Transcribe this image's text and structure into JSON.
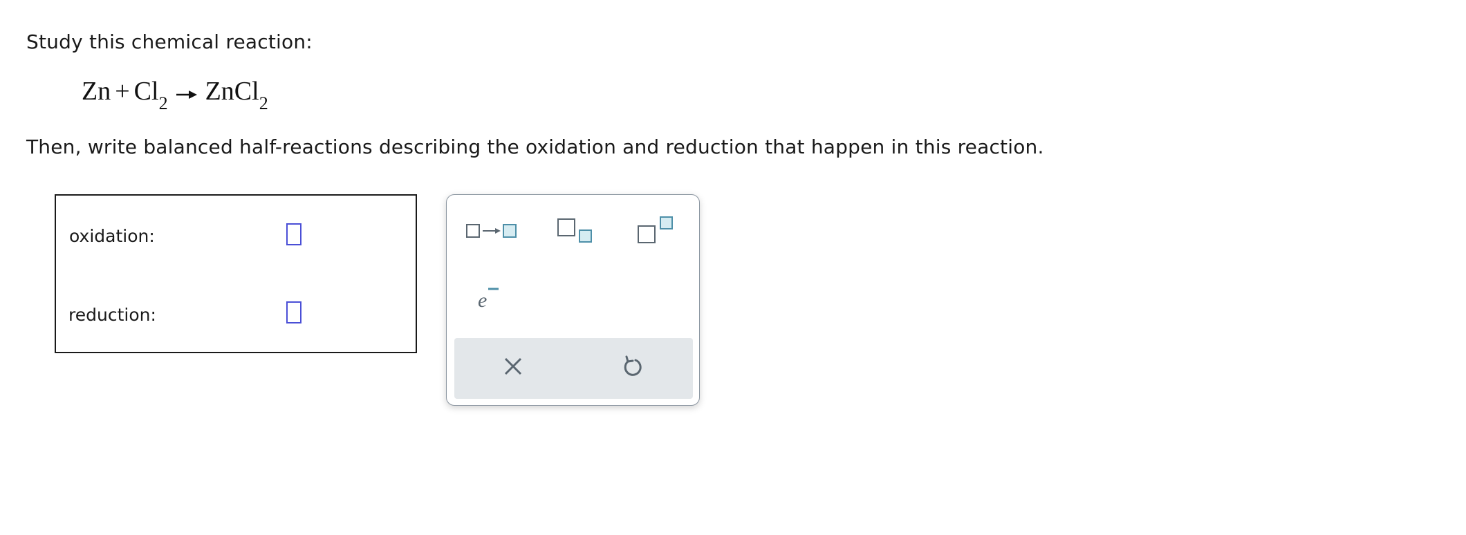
{
  "question": {
    "prompt": "Study this chemical reaction:",
    "equation": {
      "reactant1": "Zn",
      "plus": "+",
      "reactant2_symbol": "Cl",
      "reactant2_subscript": "2",
      "product_symbol": "ZnCl",
      "product_subscript": "2"
    },
    "instruction": "Then, write balanced half-reactions describing the oxidation and reduction that happen in this reaction."
  },
  "answer": {
    "rows": [
      {
        "label": "oxidation:",
        "value": ""
      },
      {
        "label": "reduction:",
        "value": ""
      }
    ]
  },
  "palette": {
    "tools": [
      "reaction-arrow-template",
      "subscript-template",
      "superscript-template",
      "electron"
    ],
    "electron_label": "e",
    "actions": [
      "clear",
      "undo"
    ],
    "colors": {
      "accent": "#4a4fd6",
      "tool_fill": "#d6ecf2",
      "tool_stroke": "#4d8fa8",
      "icon_gray": "#5a6670"
    }
  }
}
